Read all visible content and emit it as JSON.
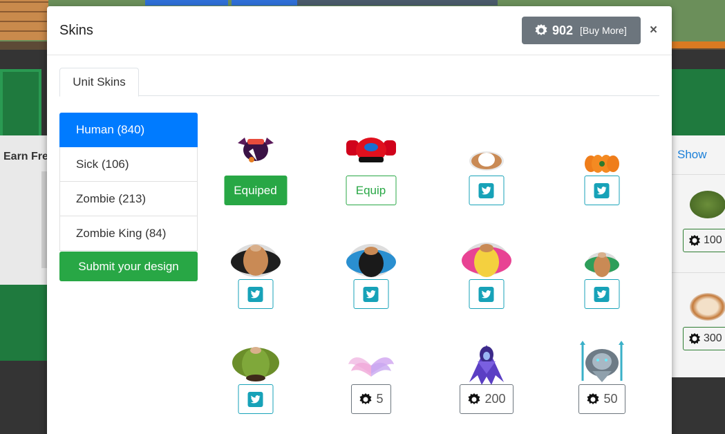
{
  "background": {
    "earn_label": "Earn Fre",
    "show_label": "Show",
    "prices": [
      "100",
      "300"
    ]
  },
  "modal": {
    "title": "Skins",
    "coins": "902",
    "buy_more": "[Buy More]",
    "close": "×"
  },
  "tabs": [
    {
      "label": "Unit Skins"
    }
  ],
  "categories": [
    {
      "label": "Human (840)",
      "active": true
    },
    {
      "label": "Sick (106)"
    },
    {
      "label": "Zombie (213)"
    },
    {
      "label": "Zombie King (84)"
    }
  ],
  "submit_label": "Submit your design",
  "skins": [
    {
      "button": "Equiped"
    },
    {
      "button": "Equip"
    },
    {
      "button": "twitter"
    },
    {
      "button": "twitter"
    },
    {
      "button": "twitter"
    },
    {
      "button": "twitter"
    },
    {
      "button": "twitter"
    },
    {
      "button": "twitter"
    },
    {
      "button": "twitter"
    },
    {
      "button": "price",
      "price": "5"
    },
    {
      "button": "price",
      "price": "200"
    },
    {
      "button": "price",
      "price": "50"
    }
  ],
  "colors": {
    "primary": "#007bff",
    "success": "#28a745",
    "info": "#17a2b8",
    "secondary": "#6c757d"
  },
  "icons": [
    "gear-icon",
    "twitter-icon",
    "close-icon"
  ]
}
